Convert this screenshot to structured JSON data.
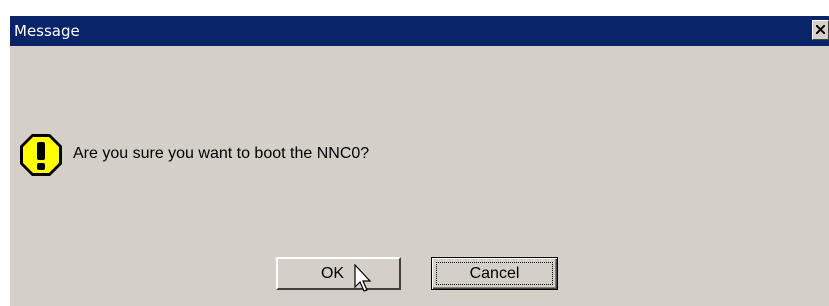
{
  "dialog": {
    "title": "Message",
    "close_icon": "close-icon",
    "message": "Are you sure you want to boot the NNC0?",
    "icon": "warning-icon",
    "buttons": {
      "ok_label": "OK",
      "cancel_label": "Cancel"
    }
  },
  "colors": {
    "titlebar": "#0a246a",
    "face": "#d4d0c8",
    "warning_fill": "#ffff00"
  }
}
